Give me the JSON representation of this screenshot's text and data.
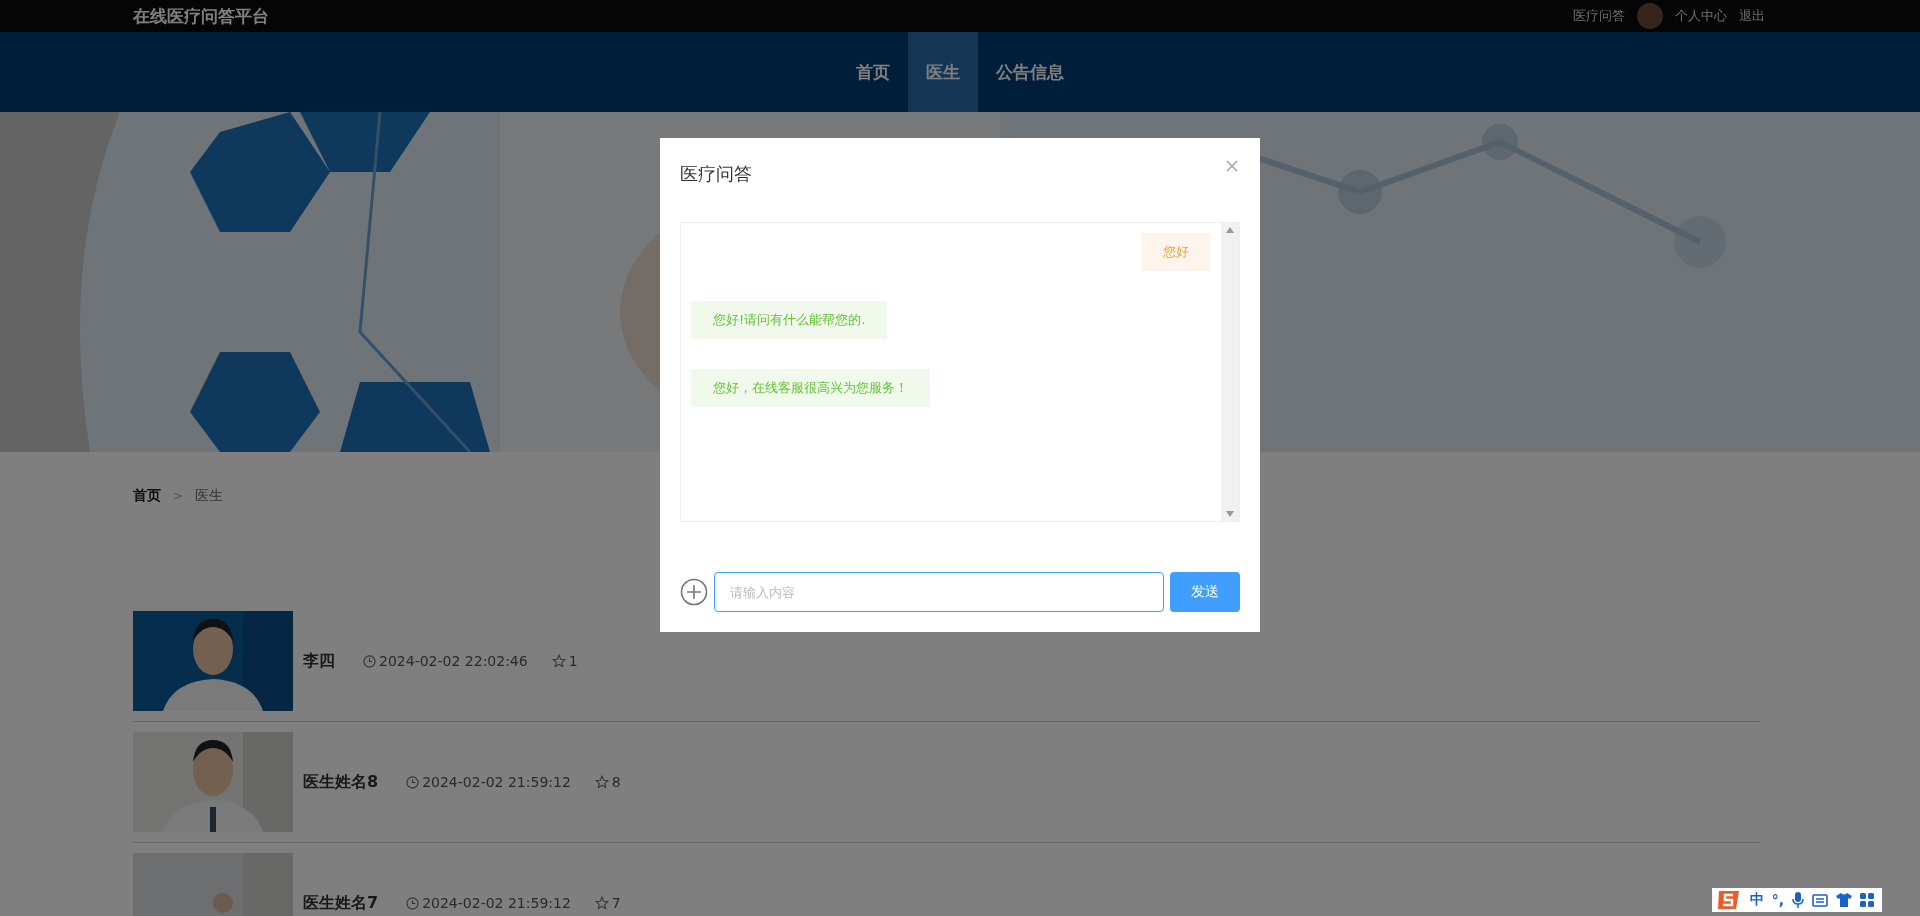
{
  "top_bar": {
    "title": "在线医疗问答平台",
    "links": [
      {
        "kind": "text",
        "label": "医疗问答"
      },
      {
        "kind": "avatar"
      },
      {
        "kind": "text",
        "label": "个人中心"
      },
      {
        "kind": "text",
        "label": "退出"
      }
    ]
  },
  "nav": {
    "items": [
      {
        "label": "首页",
        "selected": false
      },
      {
        "label": "医生",
        "selected": true
      },
      {
        "label": "公告信息",
        "selected": false
      }
    ]
  },
  "breadcrumb": {
    "separator": ">",
    "items": [
      {
        "label": "首页",
        "current": false
      },
      {
        "label": "医生",
        "current": true
      }
    ]
  },
  "doctors": [
    {
      "name": "李四",
      "time": "2024-02-02 22:02:46",
      "count": "1"
    },
    {
      "name": "医生姓名8",
      "time": "2024-02-02 21:59:12",
      "count": "8"
    },
    {
      "name": "医生姓名7",
      "time": "2024-02-02 21:59:12",
      "count": "7"
    }
  ],
  "modal": {
    "title": "医疗问答",
    "messages": [
      {
        "kind": "sent",
        "text": "您好"
      },
      {
        "kind": "received",
        "text": "您好!请问有什么能帮您的."
      },
      {
        "kind": "received",
        "text": "您好，在线客服很高兴为您服务！"
      }
    ],
    "input": {
      "placeholder": "请输入内容"
    },
    "send_button": "发送"
  },
  "ime_bar": {
    "mode": "中",
    "punctuation": "°,"
  }
}
